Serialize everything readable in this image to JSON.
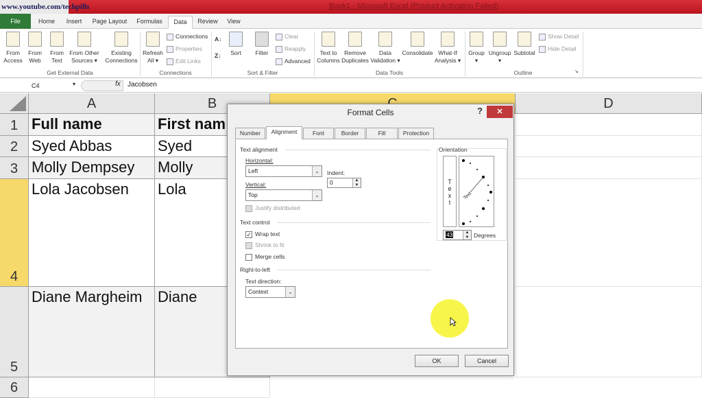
{
  "titlebar": {
    "watermark": "www.youtube.com/techpills",
    "title": "Book1 - Microsoft Excel (Product Activation Failed)"
  },
  "ribbon_tabs": [
    "File",
    "Home",
    "Insert",
    "Page Layout",
    "Formulas",
    "Data",
    "Review",
    "View"
  ],
  "active_tab": "Data",
  "ribbon": {
    "get_external": {
      "label": "Get External Data",
      "buttons": [
        "From\nAccess",
        "From\nWeb",
        "From\nText",
        "From Other\nSources ▾",
        "Existing\nConnections"
      ]
    },
    "connections": {
      "label": "Connections",
      "refresh": "Refresh\nAll ▾",
      "items": [
        "Connections",
        "Properties",
        "Edit Links"
      ]
    },
    "sort_filter": {
      "label": "Sort & Filter",
      "sort": "Sort",
      "filter": "Filter",
      "items": [
        "Clear",
        "Reapply",
        "Advanced"
      ]
    },
    "data_tools": {
      "label": "Data Tools",
      "buttons": [
        "Text to\nColumns",
        "Remove\nDuplicates",
        "Data\nValidation ▾",
        "Consolidate",
        "What-If\nAnalysis ▾"
      ]
    },
    "outline": {
      "label": "Outline",
      "buttons": [
        "Group\n▾",
        "Ungroup\n▾",
        "Subtotal"
      ],
      "items": [
        "Show Detail",
        "Hide Detail"
      ]
    }
  },
  "formula_bar": {
    "name_box": "C4",
    "fx": "fx",
    "value": "Jacobsen"
  },
  "grid": {
    "columns": [
      "A",
      "B",
      "C",
      "D"
    ],
    "rows": [
      "1",
      "2",
      "3",
      "4",
      "5",
      "6"
    ],
    "cells": [
      [
        "Full name",
        "First nam"
      ],
      [
        "Syed Abbas",
        "Syed"
      ],
      [
        "Molly Dempsey",
        "Molly"
      ],
      [
        "Lola Jacobsen",
        "Lola"
      ],
      [
        "Diane Margheim",
        "Diane"
      ],
      [
        "",
        ""
      ]
    ]
  },
  "dialog": {
    "title": "Format Cells",
    "help": "?",
    "close": "✕",
    "tabs": [
      "Number",
      "Alignment",
      "Font",
      "Border",
      "Fill",
      "Protection"
    ],
    "active_tab": "Alignment",
    "text_alignment": {
      "section": "Text alignment",
      "horizontal_label": "Horizontal:",
      "horizontal_value": "Left",
      "vertical_label": "Vertical:",
      "vertical_value": "Top",
      "indent_label": "Indent:",
      "indent_value": "0",
      "justify_distributed": "Justify distributed"
    },
    "text_control": {
      "section": "Text control",
      "wrap_text": "Wrap text",
      "wrap_text_checked": true,
      "shrink_to_fit": "Shrink to fit",
      "shrink_to_fit_checked": false,
      "merge_cells": "Merge cells",
      "merge_cells_checked": false
    },
    "rtl": {
      "section": "Right-to-left",
      "direction_label": "Text direction:",
      "direction_value": "Context"
    },
    "orientation": {
      "section": "Orientation",
      "vertical_text": "T\ne\nx\nt",
      "arc_text": "Text",
      "degrees_value": "43",
      "degrees_label": "Degrees"
    },
    "ok": "OK",
    "cancel": "Cancel"
  }
}
